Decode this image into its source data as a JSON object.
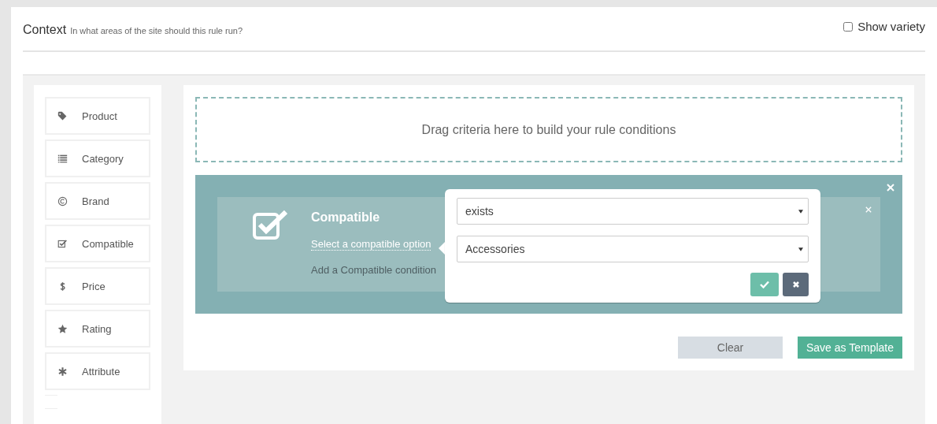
{
  "header": {
    "title": "Context",
    "subtitle": "In what areas of the site should this rule run?",
    "show_variety": {
      "label": "Show variety",
      "checked": false
    }
  },
  "sidebar": {
    "items": [
      {
        "label": "Product"
      },
      {
        "label": "Category"
      },
      {
        "label": "Brand"
      },
      {
        "label": "Compatible"
      },
      {
        "label": "Price"
      },
      {
        "label": "Rating"
      },
      {
        "label": "Attribute"
      }
    ]
  },
  "builder": {
    "dropzone": "Drag criteria here to build your rule conditions",
    "condition": {
      "title": "Compatible",
      "link": "Select a compatible option",
      "hint": "Add a Compatible condition"
    },
    "popover": {
      "selects": [
        {
          "value": "exists"
        },
        {
          "value": "Accessories"
        }
      ]
    },
    "buttons": [
      {
        "label": "Clear",
        "kind": "secondary"
      },
      {
        "label": "Save as Template",
        "kind": "primary"
      }
    ]
  }
}
